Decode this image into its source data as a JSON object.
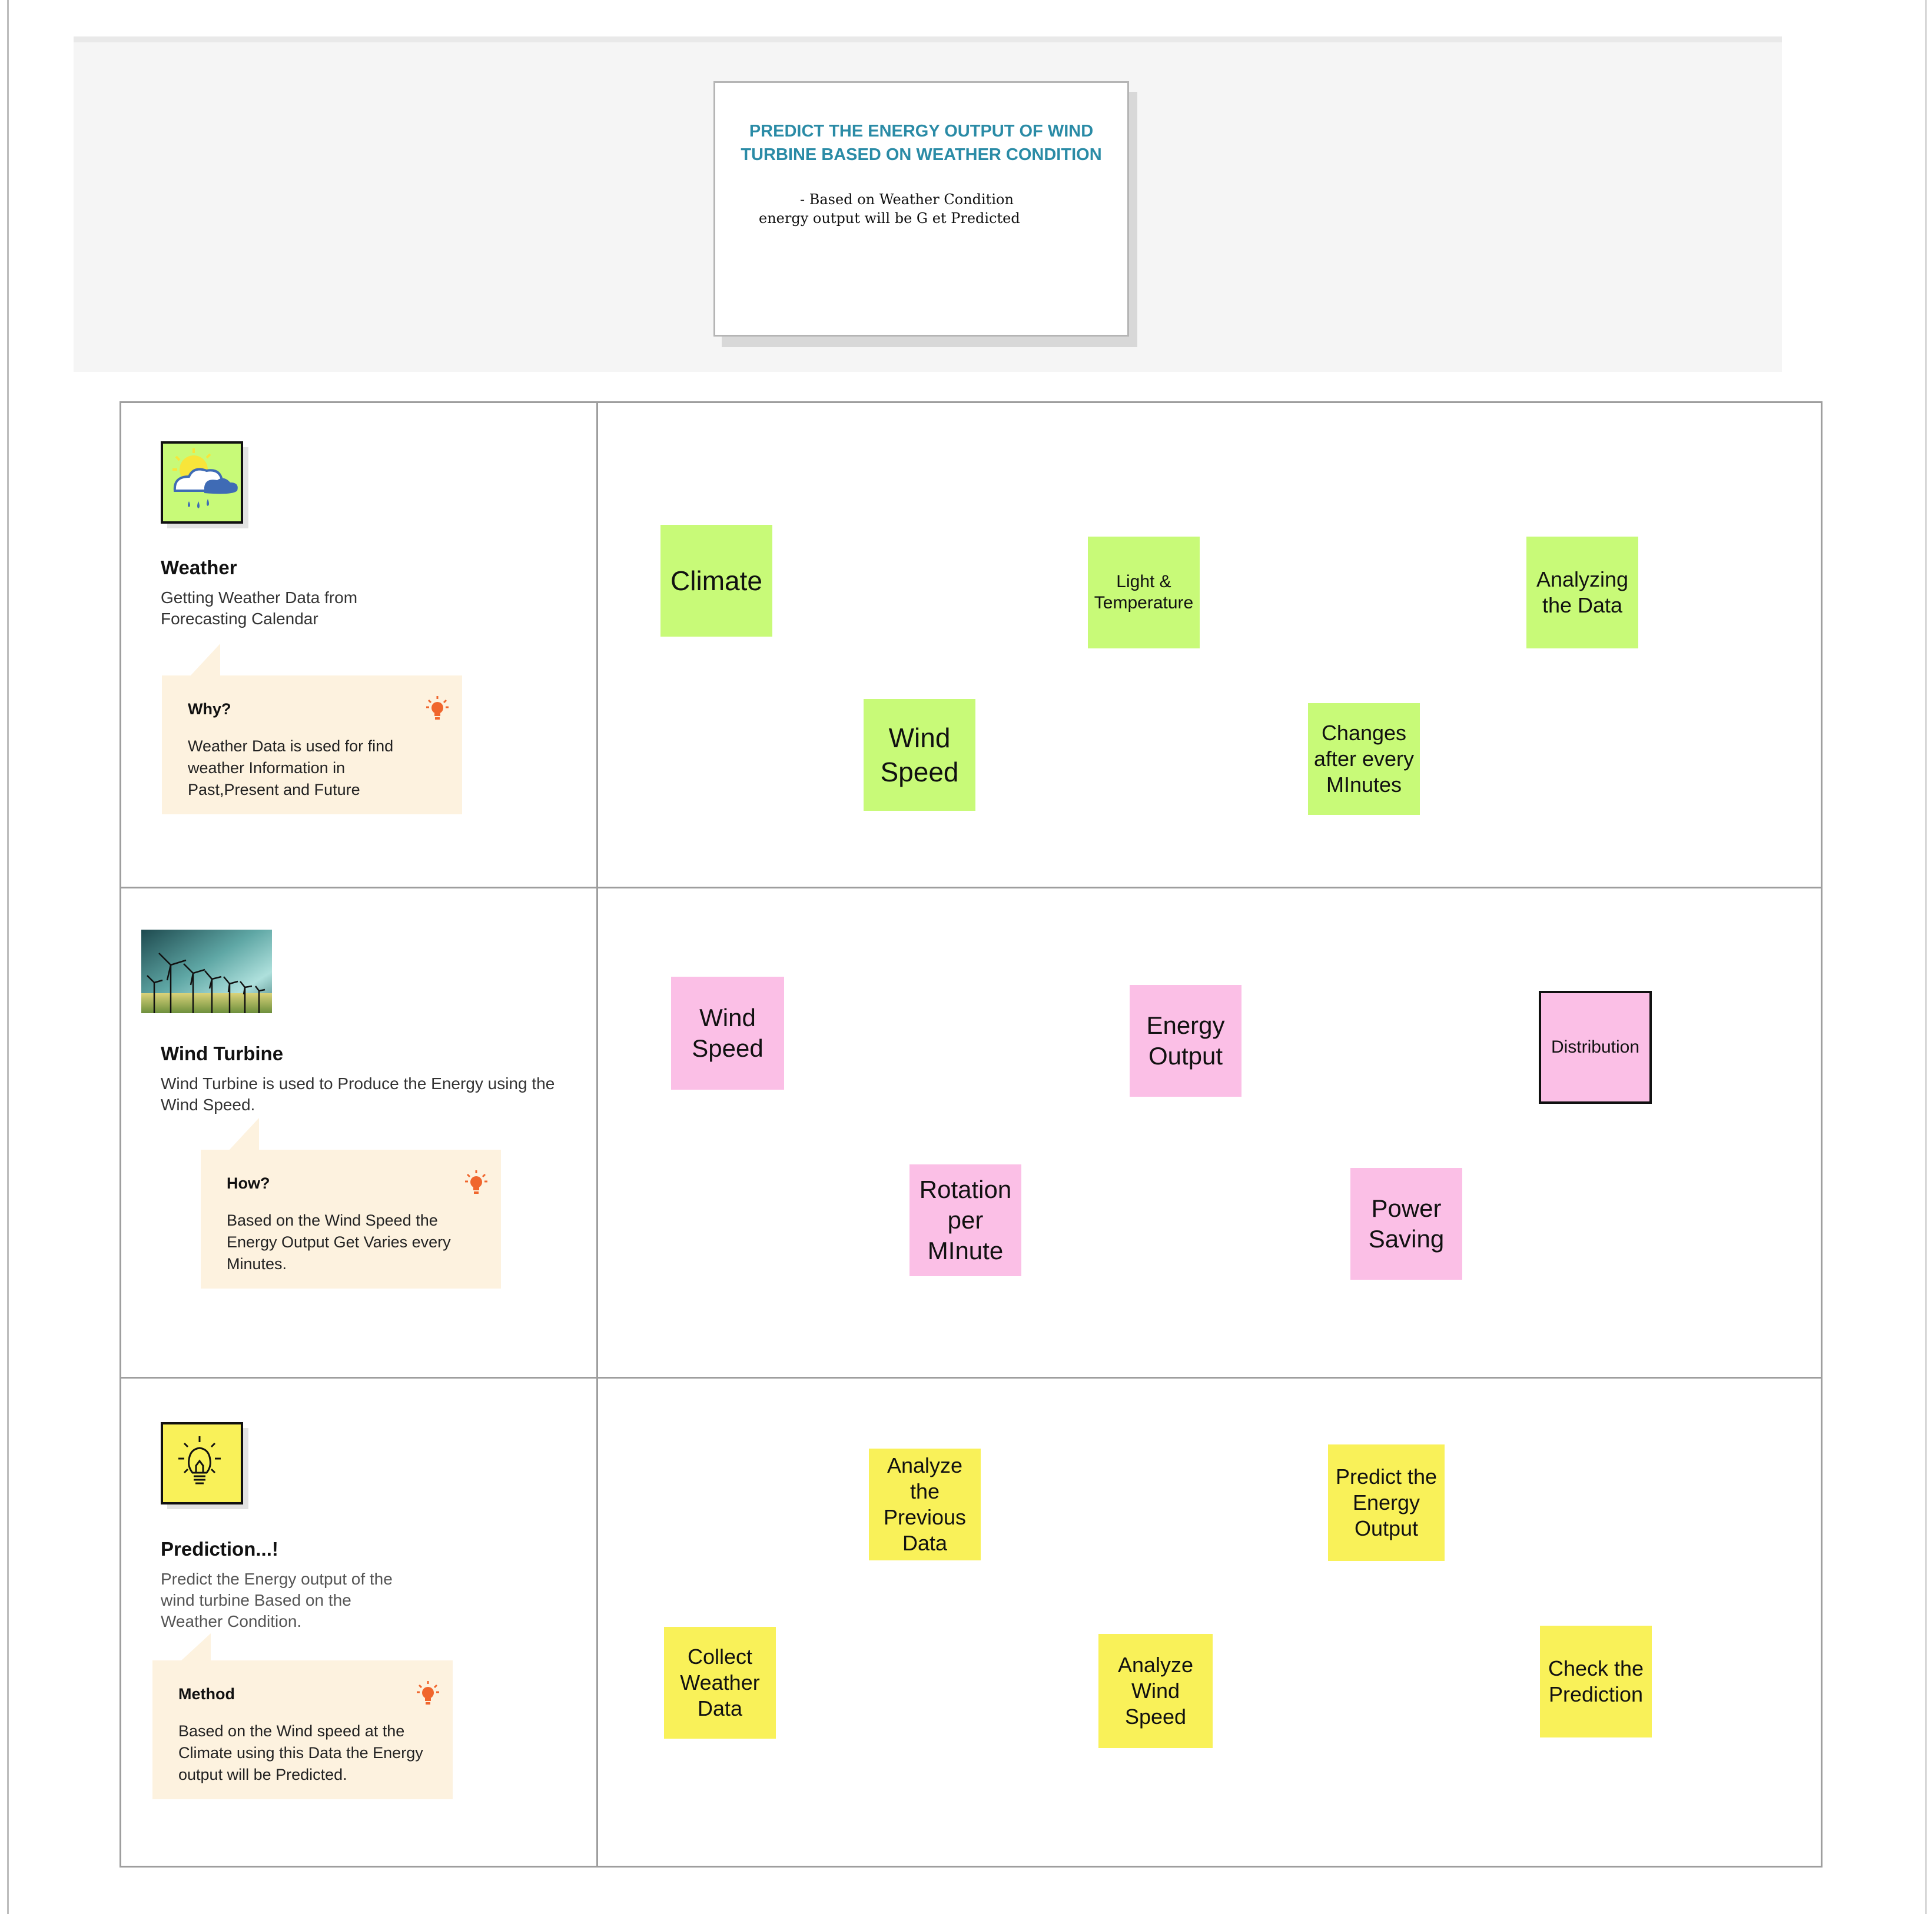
{
  "header": {
    "title": "PREDICT THE ENERGY OUTPUT OF WIND TURBINE BASED ON WEATHER CONDITION",
    "subtitle": "- Based on Weather Condition energy output will be G et Predicted"
  },
  "rows": [
    {
      "icon": "weather-cloud-rain-sun-icon",
      "title": "Weather",
      "description": "Getting Weather Data from Forecasting Calendar",
      "callout": {
        "heading": "Why?",
        "body": "Weather Data is used for find weather Information in Past,Present and Future"
      },
      "stickies": [
        "Climate",
        "Light & Temperature",
        "Analyzing the Data",
        "Wind Speed",
        "Changes after every MInutes"
      ]
    },
    {
      "icon": "wind-turbine-photo-icon",
      "title": "Wind Turbine",
      "description": "Wind Turbine is used to Produce the Energy using the Wind Speed.",
      "callout": {
        "heading": "How?",
        "body": "Based on the Wind Speed the Energy Output Get Varies every Minutes."
      },
      "stickies": [
        "Wind Speed",
        "Energy Output",
        "Distribution",
        "Rotation per MInute",
        "Power Saving"
      ]
    },
    {
      "icon": "lightbulb-icon",
      "title": "Prediction...!",
      "description": "Predict the Energy output of the wind turbine Based on the Weather Condition.",
      "callout": {
        "heading": "Method",
        "body": "Based on the Wind speed at the Climate using this Data the Energy output will be Predicted."
      },
      "stickies": [
        "Analyze the Previous Data",
        "Predict the Energy Output",
        "Collect Weather Data",
        "Analyze Wind Speed",
        "Check the Prediction"
      ]
    }
  ],
  "colors": {
    "title": "#2a8ba6",
    "sticky_green": "#c8fa78",
    "sticky_pink": "#fbbfe6",
    "sticky_yellow": "#f9f159",
    "callout": "#fdf2df",
    "bulb": "#f0662d"
  }
}
